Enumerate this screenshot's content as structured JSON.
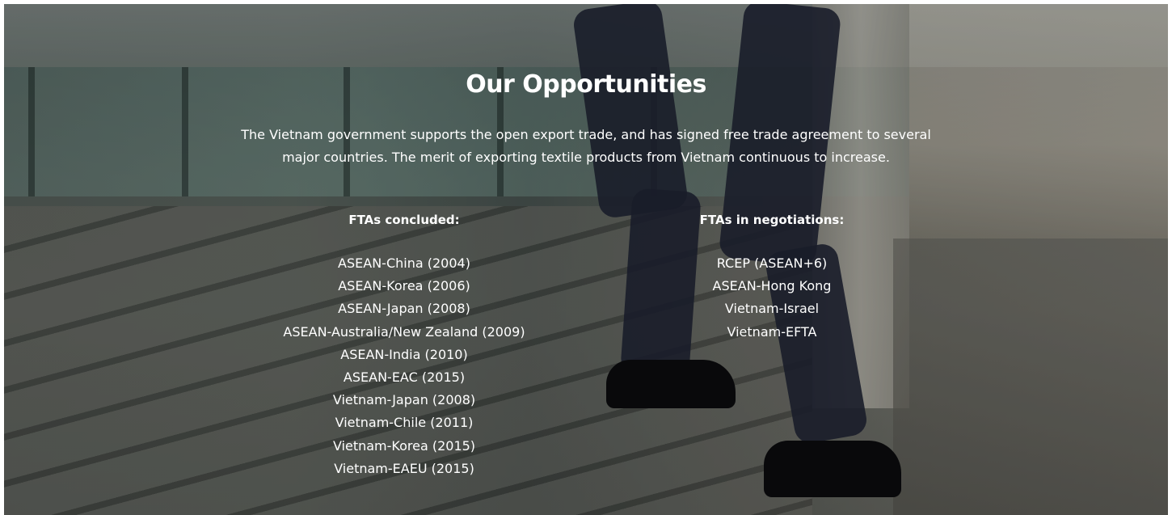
{
  "title": "Our Opportunities",
  "intro": "The Vietnam government supports the open export trade, and has signed free trade agreement to several major countries. The merit of exporting textile products from Vietnam continuous to increase.",
  "concluded": {
    "heading": "FTAs concluded:",
    "items": [
      "ASEAN-China (2004)",
      "ASEAN-Korea (2006)",
      "ASEAN-Japan (2008)",
      "ASEAN-Australia/New Zealand (2009)",
      "ASEAN-India (2010)",
      "ASEAN-EAC (2015)",
      "Vietnam-Japan (2008)",
      "Vietnam-Chile (2011)",
      "Vietnam-Korea (2015)",
      "Vietnam-EAEU (2015)"
    ]
  },
  "negotiations": {
    "heading": "FTAs in negotiations:",
    "items": [
      "RCEP (ASEAN+6)",
      "ASEAN-Hong Kong",
      "Vietnam-Israel",
      "Vietnam-EFTA"
    ]
  }
}
